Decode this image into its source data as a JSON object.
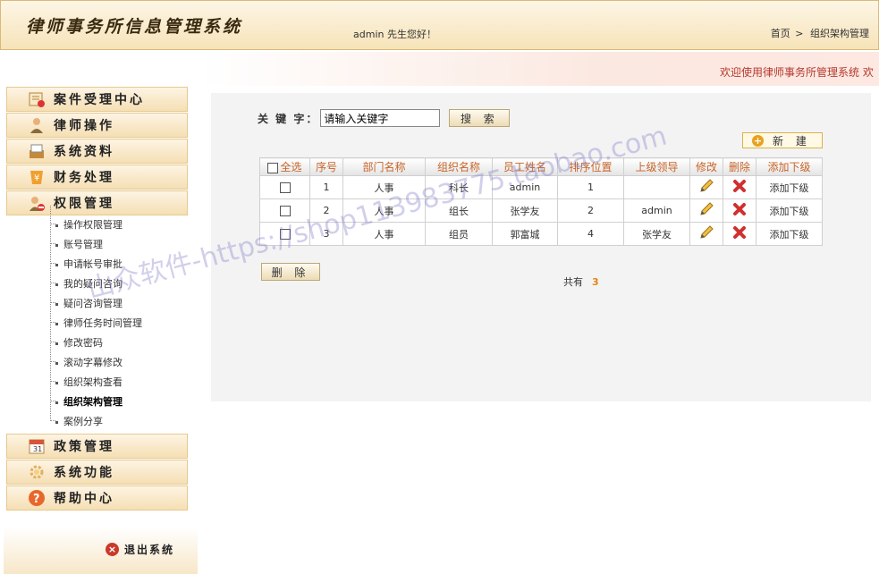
{
  "header": {
    "title": "律师事务所信息管理系统",
    "welcome": "admin 先生您好！",
    "breadcrumb": {
      "home": "首页",
      "separator": ">",
      "current": "组织架构管理"
    }
  },
  "sidebar": {
    "menus": [
      {
        "label": "案件受理中心",
        "icon": "certificate-icon"
      },
      {
        "label": "律师操作",
        "icon": "person-icon"
      },
      {
        "label": "系统资料",
        "icon": "document-icon"
      },
      {
        "label": "财务处理",
        "icon": "money-icon"
      },
      {
        "label": "权限管理",
        "icon": "lock-icon"
      },
      {
        "label": "政策管理",
        "icon": "calendar-icon"
      },
      {
        "label": "系统功能",
        "icon": "gear-icon"
      },
      {
        "label": "帮助中心",
        "icon": "help-icon"
      }
    ],
    "submenu": [
      "操作权限管理",
      "账号管理",
      "申请帐号审批",
      "我的疑问咨询",
      "疑问咨询管理",
      "律师任务时间管理",
      "修改密码",
      "滚动字幕修改",
      "组织架构查看",
      "组织架构管理",
      "案例分享"
    ],
    "active_submenu": "组织架构管理",
    "logout": "退出系统"
  },
  "marquee": {
    "text": "欢迎使用律师事务所管理系统   欢"
  },
  "search": {
    "label": "关 键 字：",
    "value": "请输入关键字",
    "button": "搜 索"
  },
  "new_button": "新 建",
  "table": {
    "headers": [
      "全选",
      "序号",
      "部门名称",
      "组织名称",
      "员工姓名",
      "排序位置",
      "上级领导",
      "修改",
      "删除",
      "添加下级"
    ],
    "rows": [
      {
        "seq": "1",
        "dept": "人事",
        "org": "科长",
        "name": "admin",
        "order": "1",
        "leader": "",
        "add": "添加下级"
      },
      {
        "seq": "2",
        "dept": "人事",
        "org": "组长",
        "name": "张学友",
        "order": "2",
        "leader": "admin",
        "add": "添加下级"
      },
      {
        "seq": "3",
        "dept": "人事",
        "org": "组员",
        "name": "郭富城",
        "order": "4",
        "leader": "张学友",
        "add": "添加下级"
      }
    ]
  },
  "delete_button": "删 除",
  "total": {
    "label": "共有",
    "count": "3"
  },
  "watermark": "山众软件-https://shop113983775.taobao.com",
  "colors": {
    "accent": "#c86428",
    "header_bg": "#f6e3b8",
    "count": "#e0841a"
  }
}
